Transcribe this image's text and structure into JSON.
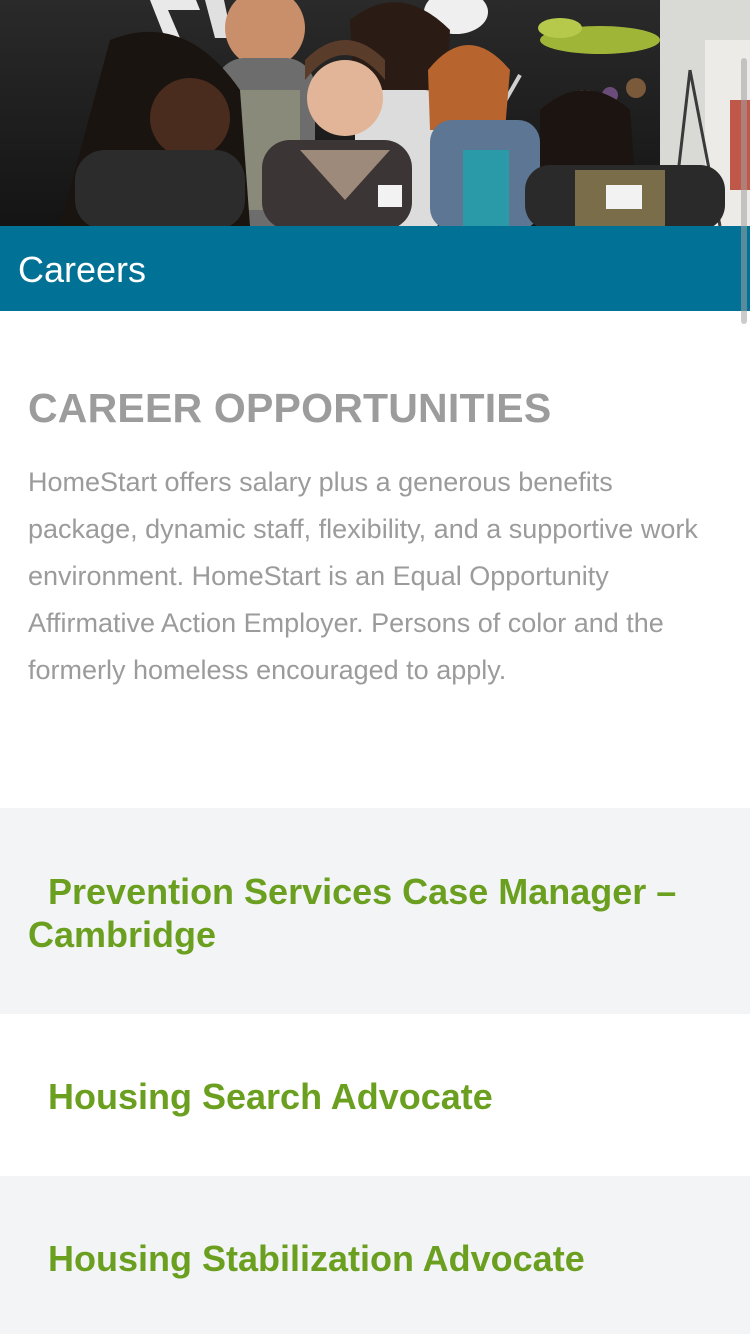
{
  "banner": {
    "title": "Careers"
  },
  "intro": {
    "heading": "CAREER OPPORTUNITIES",
    "body": "HomeStart offers salary plus a generous benefits package, dynamic staff, flexibility, and a supportive work environment. HomeStart is an Equal Opportunity Affirmative Action Employer. Persons of color and the formerly homeless encouraged to apply."
  },
  "jobs": [
    {
      "title": "Prevention Services Case Manager – Cambridge"
    },
    {
      "title": "Housing Search Advocate"
    },
    {
      "title": "Housing Stabilization Advocate"
    }
  ],
  "colors": {
    "banner": "#027196",
    "job_link": "#6b9f1f",
    "heading_text": "#9c9c9c",
    "alt_row": "#f3f4f5"
  },
  "icons": {
    "hero": "group-photo"
  }
}
